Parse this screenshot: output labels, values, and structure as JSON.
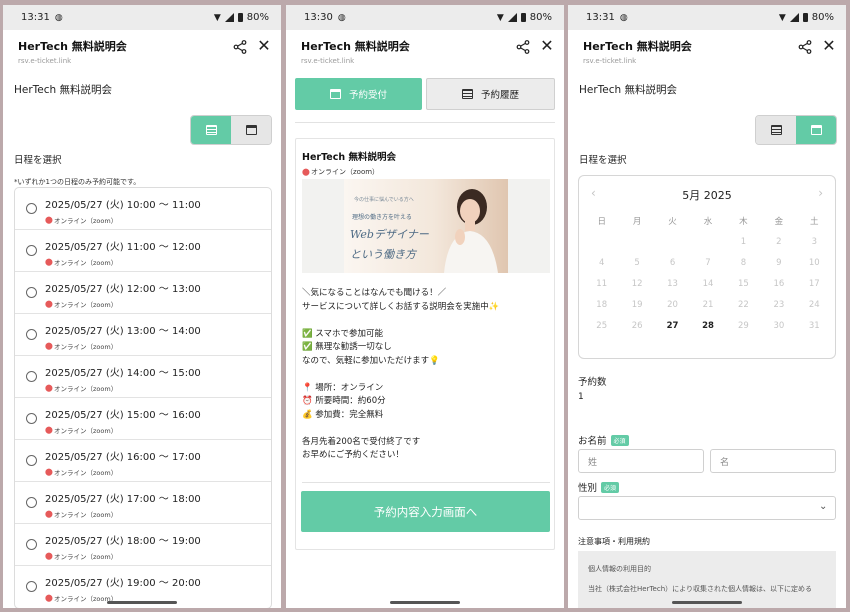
{
  "status": {
    "p1_time": "13:31",
    "p2_time": "13:30",
    "p3_time": "13:31",
    "battery": "80%"
  },
  "app": {
    "title": "HerTech 無料説明会",
    "url": "rsv.e-ticket.link"
  },
  "screen1": {
    "page_title": "HerTech 無料説明会",
    "section_label": "日程を選択",
    "note": "*いずれか1つの日程のみ予約可能です。",
    "slots": [
      {
        "time": "2025/05/27 (火) 10:00 ～ 11:00",
        "location": "オンライン（zoom）"
      },
      {
        "time": "2025/05/27 (火) 11:00 ～ 12:00",
        "location": "オンライン（zoom）"
      },
      {
        "time": "2025/05/27 (火) 12:00 ～ 13:00",
        "location": "オンライン（zoom）"
      },
      {
        "time": "2025/05/27 (火) 13:00 ～ 14:00",
        "location": "オンライン（zoom）"
      },
      {
        "time": "2025/05/27 (火) 14:00 ～ 15:00",
        "location": "オンライン（zoom）"
      },
      {
        "time": "2025/05/27 (火) 15:00 ～ 16:00",
        "location": "オンライン（zoom）"
      },
      {
        "time": "2025/05/27 (火) 16:00 ～ 17:00",
        "location": "オンライン（zoom）"
      },
      {
        "time": "2025/05/27 (火) 17:00 ～ 18:00",
        "location": "オンライン（zoom）"
      },
      {
        "time": "2025/05/27 (火) 18:00 ～ 19:00",
        "location": "オンライン（zoom）"
      },
      {
        "time": "2025/05/27 (火) 19:00 ～ 20:00",
        "location": "オンライン（zoom）"
      }
    ]
  },
  "screen2": {
    "tab_reserve": "予約受付",
    "tab_history": "予約履歴",
    "card_title": "HerTech 無料説明会",
    "card_location": "オンライン（zoom）",
    "banner": {
      "tag": "今の仕事に悩んでいる方へ",
      "main": "理想の働き方を叶える",
      "script": "Webデザイナー",
      "sub": "という働き方"
    },
    "desc": {
      "l1": "＼気になることはなんでも聞ける！／",
      "l2": "サービスについて詳しくお話する説明会を実施中✨",
      "l3": "✅ スマホで参加可能",
      "l4": "✅ 無理な勧誘一切なし",
      "l5": "なので、気軽に参加いただけます💡",
      "l6": "📍 場所：オンライン",
      "l7": "⏰ 所要時間：約60分",
      "l8": "💰 参加費：完全無料",
      "l9": "各月先着200名で受付終了です",
      "l10": "お早めにご予約ください！"
    },
    "cta": "予約内容入力画面へ"
  },
  "screen3": {
    "page_title": "HerTech 無料説明会",
    "section_label": "日程を選択",
    "calendar": {
      "month": "5月 2025",
      "weekdays": [
        "日",
        "月",
        "火",
        "水",
        "木",
        "金",
        "土"
      ],
      "days": [
        "",
        "",
        "",
        "",
        "1",
        "2",
        "3",
        "4",
        "5",
        "6",
        "7",
        "8",
        "9",
        "10",
        "11",
        "12",
        "13",
        "14",
        "15",
        "16",
        "17",
        "18",
        "19",
        "20",
        "21",
        "22",
        "23",
        "24",
        "25",
        "26",
        "27",
        "28",
        "29",
        "30",
        "31"
      ],
      "available": [
        "27",
        "28"
      ]
    },
    "qty_label": "予約数",
    "qty_value": "1",
    "name_label": "お名前",
    "required": "必須",
    "last_name_placeholder": "姓",
    "first_name_placeholder": "名",
    "gender_label": "性別",
    "terms_label": "注意事項・利用規約",
    "terms_line1": "個人情報の利用目的",
    "terms_line2": "当社（株式会社HerTech）により収集された個人情報は、以下に定める"
  },
  "colors": {
    "accent": "#63cba6",
    "pin": "#e65a5a",
    "frame": "#bca9ab"
  }
}
